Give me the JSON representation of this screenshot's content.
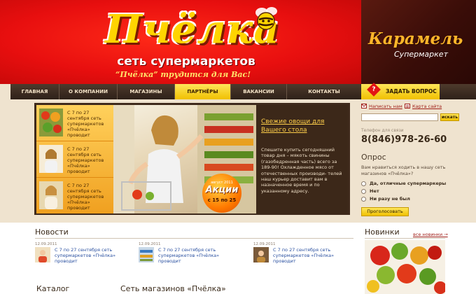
{
  "header": {
    "logo_title": "Пчёлка",
    "logo_subtitle": "сеть супермаркетов",
    "logo_slogan": "“Пчёлка” трудится для Вас!",
    "partner_title": "Карамель",
    "partner_subtitle": "Супермаркет"
  },
  "nav": {
    "items": [
      {
        "label": "ГЛАВНАЯ"
      },
      {
        "label": "О КОМПАНИИ"
      },
      {
        "label": "МАГАЗИНЫ"
      },
      {
        "label": "ПАРТНЁРЫ"
      },
      {
        "label": "ВАКАНСИИ"
      },
      {
        "label": "КОНТАКТЫ"
      }
    ],
    "active_index": 3,
    "ask_label": "ЗАДАТЬ ВОПРОС",
    "ask_mark": "?"
  },
  "promo": {
    "thumbs": [
      {
        "text": "С 7 по 27 сентября сеть супермаркетов «Пчёлка» проводит"
      },
      {
        "text": "С 7 по 27 сентября сеть супермаркетов «Пчёлка» проводит"
      },
      {
        "text": "С 7 по 27 сентября сеть супермаркетов «Пчёлка» проводит"
      }
    ],
    "title": "Свежие овощи для Вашего стола",
    "body": "Спешите купить сегодняшний товар дня – мякоть свинины (газобедренная часть) всего за 189-90! Охлажденное мясо от отечественных производи- телей наш курьер доставит вам в назначенное время и по указанному адресу.",
    "badge_small": "август 2011",
    "badge_word": "Акции",
    "badge_date": "с 15 по 25"
  },
  "sidebar": {
    "write_us": "Написать нам",
    "site_map": "Карта сайта",
    "search_button": "искать",
    "search_placeholder": "",
    "phone_label": "Телефон для связи",
    "phone": "8(846)978-26-60",
    "poll_title": "Опрос",
    "poll_question": "Вам нравиться ходить в нашу сеть магазинов «Пчёлка»?",
    "poll_options": [
      {
        "label": "Да, отличные супермаркеры"
      },
      {
        "label": "Нет"
      },
      {
        "label": "Ни разу не был"
      }
    ],
    "vote_button": "Проголосовать"
  },
  "news": {
    "title": "Новости",
    "items": [
      {
        "date": "12.09.2011",
        "text": "С 7 по 27 сентября сеть супермаркетов «Пчёлка» проводит"
      },
      {
        "date": "12.09.2011",
        "text": "С 7 по 27 сентября сеть супермаркетов «Пчёлка» проводит"
      },
      {
        "date": "12.09.2011",
        "text": "С 7 по 27 сентября сеть супермаркетов «Пчёлка» проводит"
      }
    ]
  },
  "novinki": {
    "title": "Новинки",
    "all_link": "все новинки →"
  },
  "catalog": {
    "title": "Каталог"
  },
  "network": {
    "title": "Сеть магазинов «Пчёлка»"
  }
}
